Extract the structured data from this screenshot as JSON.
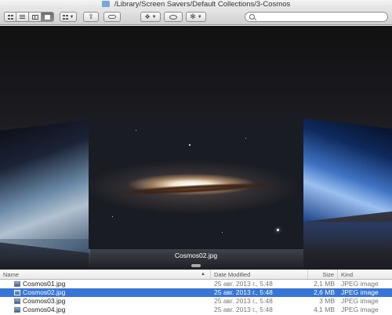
{
  "window": {
    "title": "/Library/Screen Savers/Default Collections/3-Cosmos"
  },
  "toolbar": {
    "view_modes": [
      "icon-view",
      "list-view",
      "column-view",
      "cover-flow-view"
    ],
    "active_view": "cover-flow-view"
  },
  "search": {
    "placeholder": "",
    "value": ""
  },
  "coverflow": {
    "caption": "Cosmos02.jpg"
  },
  "list": {
    "columns": {
      "name": "Name",
      "date": "Date Modified",
      "size": "Size",
      "kind": "Kind"
    },
    "rows": [
      {
        "name": "Cosmos01.jpg",
        "date": "25 авг. 2013 г., 5:48",
        "size": "2,1 MB",
        "kind": "JPEG image"
      },
      {
        "name": "Cosmos02.jpg",
        "date": "25 авг. 2013 г., 5:48",
        "size": "2,6 MB",
        "kind": "JPEG image",
        "selected": true
      },
      {
        "name": "Cosmos03.jpg",
        "date": "25 авг. 2013 г., 5:48",
        "size": "3 MB",
        "kind": "JPEG image"
      },
      {
        "name": "Cosmos04.jpg",
        "date": "25 авг. 2013 г., 5:48",
        "size": "4,1 MB",
        "kind": "JPEG image"
      }
    ]
  },
  "colors": {
    "selection": "#3875d7",
    "accent_folder": "#7aa7d8"
  }
}
